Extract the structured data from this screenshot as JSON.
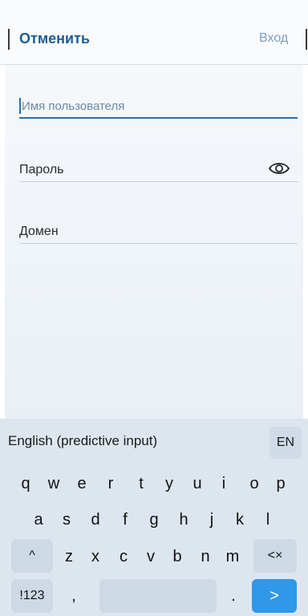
{
  "header": {
    "cancel_label": "Отменить",
    "login_label": "Вход"
  },
  "fields": {
    "username_placeholder": "Имя пользователя",
    "password_placeholder": "Пароль",
    "domain_placeholder": "Домен"
  },
  "keyboard": {
    "title": "English (predictive input)",
    "lang_label": "EN",
    "row1": [
      "q",
      "w",
      "e",
      "r",
      "t",
      "y",
      "u",
      "i",
      "o",
      "p"
    ],
    "row2": [
      "a",
      "s",
      "d",
      "f",
      "g",
      "h",
      "j",
      "k",
      "l"
    ],
    "row3": [
      "z",
      "x",
      "c",
      "v",
      "b",
      "n",
      "m"
    ],
    "shift_icon": "^",
    "backspace_icon": "<×",
    "num_label": "!123",
    "comma": ",",
    "period": ".",
    "enter_icon": ">"
  },
  "colors": {
    "accent": "#1d5d93",
    "enter_button": "#2f98e8"
  }
}
